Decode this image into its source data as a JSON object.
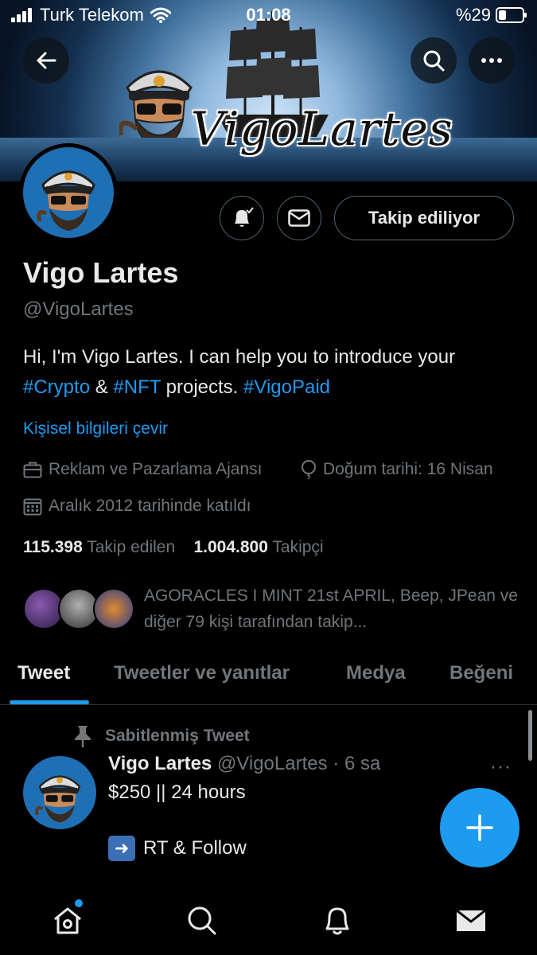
{
  "status_bar": {
    "carrier": "Turk Telekom",
    "time": "01:08",
    "battery": "%29"
  },
  "banner": {
    "brand_text": "VigoLartes"
  },
  "header_actions": {
    "back_icon": "back-arrow-icon",
    "search_icon": "search-icon",
    "more_icon": "more-icon"
  },
  "profile": {
    "follow_label": "Takip ediliyor",
    "name": "Vigo Lartes",
    "handle": "@VigoLartes",
    "bio": {
      "part1": "Hi, I'm Vigo Lartes. I can help you to introduce your ",
      "tag1": "#Crypto",
      "part2": " & ",
      "tag2": "#NFT",
      "part3": " projects. ",
      "tag3": "#VigoPaid"
    },
    "translate_label": "Kişisel bilgileri çevir",
    "category": "Reklam ve Pazarlama Ajansı",
    "birthday": "Doğum tarihi: 16 Nisan",
    "joined": "Aralık 2012 tarihinde katıldı",
    "following_count": "115.398",
    "following_label": "Takip edilen",
    "followers_count": "1.004.800",
    "followers_label": "Takipçi",
    "followed_by": "AGORACLES I MINT 21st APRIL, Beep, JPean ve diğer 79 kişi tarafından takip..."
  },
  "tabs": [
    {
      "label": "Tweet"
    },
    {
      "label": "Tweetler ve yanıtlar"
    },
    {
      "label": "Medya"
    },
    {
      "label": "Beğeni"
    }
  ],
  "tweet": {
    "pinned_label": "Sabitlenmiş Tweet",
    "author_name": "Vigo Lartes",
    "author_handle": "@VigoLartes",
    "time": "· 6 sa",
    "more": "···",
    "line1": "$250 || 24 hours",
    "line2": "RT & Follow"
  },
  "colors": {
    "accent": "#1d9bf0",
    "background": "#000000",
    "text_primary": "#e7e9ea",
    "text_secondary": "#71767b",
    "border": "#2f3336"
  }
}
